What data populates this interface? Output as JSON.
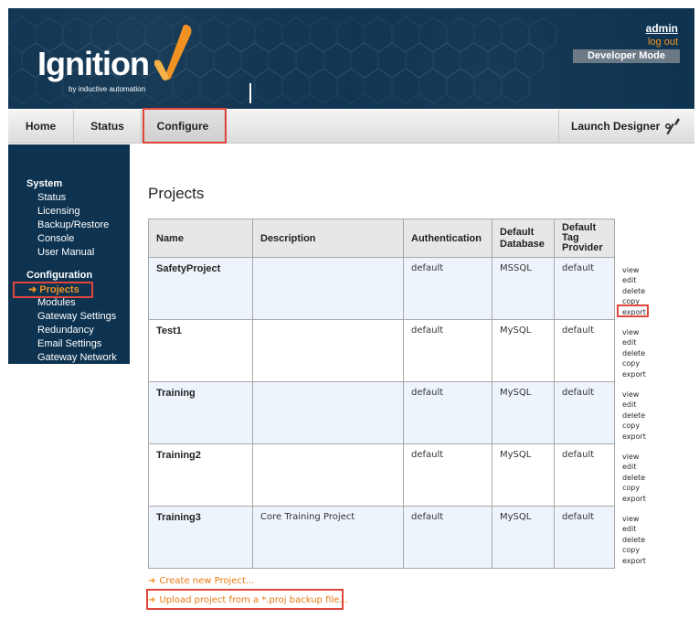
{
  "header": {
    "logo_text": "Ignition",
    "logo_subtitle": "by inductive automation",
    "user": "admin",
    "logout": "log out",
    "mode_badge": "Developer Mode",
    "colors": {
      "banner": "#0e3350",
      "accent": "#f29222",
      "highlight_box": "#e0463b"
    }
  },
  "nav": {
    "items": [
      {
        "label": "Home"
      },
      {
        "label": "Status"
      },
      {
        "label": "Configure",
        "selected": true
      }
    ],
    "launch_designer": "Launch Designer",
    "launch_icon": "wrench-icon"
  },
  "sidebar": {
    "system_heading": "System",
    "system_items": [
      "Status",
      "Licensing",
      "Backup/Restore",
      "Console",
      "User Manual"
    ],
    "config_heading": "Configuration",
    "config_active": "Projects",
    "config_items": [
      "Modules",
      "Gateway Settings",
      "Redundancy",
      "Email Settings",
      "Gateway Network"
    ]
  },
  "main": {
    "title": "Projects",
    "columns": [
      "Name",
      "Description",
      "Authentication",
      "Default Database",
      "Default Tag Provider"
    ],
    "col_default_db_line1": "Default",
    "col_default_db_line2": "Database",
    "col_tag_line1": "Default",
    "col_tag_line2": "Tag",
    "col_tag_line3": "Provider",
    "rows": [
      {
        "name": "SafetyProject",
        "description": "",
        "auth": "default",
        "database": "MSSQL",
        "tag_provider": "default"
      },
      {
        "name": "Test1",
        "description": "",
        "auth": "default",
        "database": "MySQL",
        "tag_provider": "default"
      },
      {
        "name": "Training",
        "description": "",
        "auth": "default",
        "database": "MySQL",
        "tag_provider": "default"
      },
      {
        "name": "Training2",
        "description": "",
        "auth": "default",
        "database": "MySQL",
        "tag_provider": "default"
      },
      {
        "name": "Training3",
        "description": "Core Training Project",
        "auth": "default",
        "database": "MySQL",
        "tag_provider": "default"
      }
    ],
    "actions": {
      "view": "view",
      "edit": "edit",
      "delete": "delete",
      "copy": "copy",
      "export": "export"
    },
    "create_link": "Create new Project...",
    "upload_link": "Upload project from a *.proj backup file..."
  }
}
